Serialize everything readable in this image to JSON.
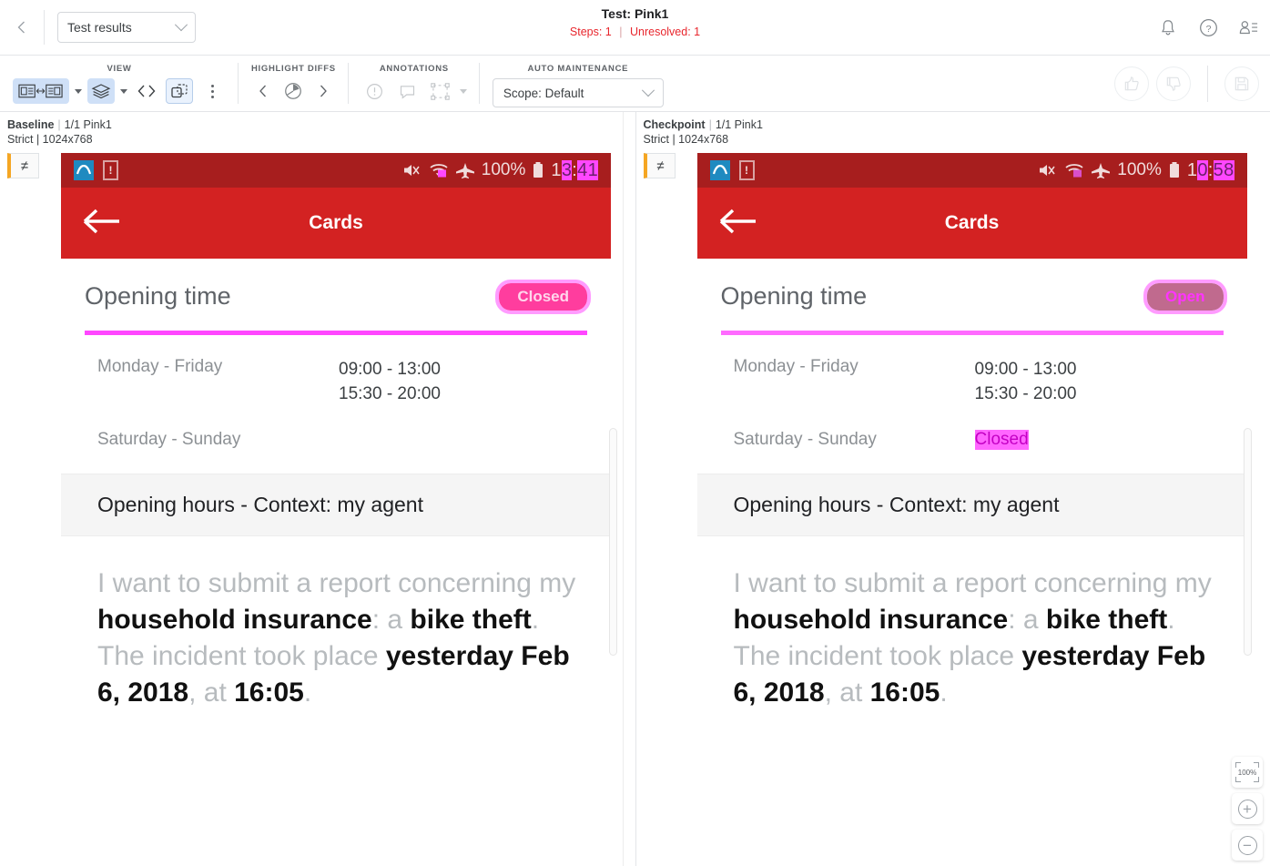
{
  "header": {
    "back_icon": "chevron-left-icon",
    "view_select": {
      "value": "Test results",
      "chevron": "chevron-down-icon"
    },
    "title": "Test: Pink1",
    "steps_label": "Steps: 1",
    "separator": "|",
    "unresolved_label": "Unresolved: 1",
    "icons": [
      "bell-icon",
      "help-icon",
      "user-list-icon"
    ],
    "accent_red": "#e8262d"
  },
  "toolbar": {
    "groups": [
      {
        "label": "VIEW",
        "items": [
          "side-by-side-icon",
          "layers-icon",
          "code-icon",
          "overlay-icon",
          "more-icon"
        ]
      },
      {
        "label": "HIGHLIGHT DIFFS",
        "items": [
          "prev-diff-icon",
          "diff-target-icon",
          "next-diff-icon"
        ]
      },
      {
        "label": "ANNOTATIONS",
        "items": [
          "issue-icon",
          "comment-icon",
          "region-icon"
        ]
      },
      {
        "label": "AUTO MAINTENANCE",
        "items": []
      }
    ],
    "view_label": "VIEW",
    "highlight_diffs_label": "HIGHLIGHT DIFFS",
    "annotations_label": "ANNOTATIONS",
    "auto_maintenance_label": "AUTO MAINTENANCE",
    "scope_select": {
      "value": "Scope: Default",
      "chevron": "chevron-down-icon"
    },
    "right_actions": [
      "thumbs-up-icon",
      "thumbs-down-icon",
      "save-icon"
    ]
  },
  "panes": {
    "baseline": {
      "kind": "Baseline",
      "sep": "|",
      "index": "1/1 Pink1",
      "meta": "Strict | 1024x768",
      "diff_chip": "≠",
      "status_bar": {
        "icons": [
          "mute-icon",
          "wifi-icon",
          "airplane-icon"
        ],
        "battery_pct": "100%",
        "battery_icon": "battery-icon",
        "time_plain_1": "1",
        "time_hl_1": "3",
        "time_colon": ":",
        "time_hl_2": "41",
        "time_full": "13:41"
      },
      "app_bar": {
        "back_icon": "arrow-left-icon",
        "title": "Cards"
      },
      "opening": {
        "title": "Opening time",
        "badge": "Closed",
        "badge_bg": "#ff3d9e",
        "badge_fg": "#ffd6ec"
      },
      "schedule": [
        {
          "day": "Monday - Friday",
          "times": [
            "09:00 - 13:00",
            "15:30 - 20:00"
          ],
          "value": "",
          "highlight": false
        },
        {
          "day": "Saturday - Sunday",
          "times": [],
          "value": "",
          "highlight": false
        }
      ],
      "context_title": "Opening hours - Context: my agent",
      "body": [
        {
          "t": "I want to submit a report concerning my ",
          "b": false
        },
        {
          "t": "household insurance",
          "b": true
        },
        {
          "t": ": ",
          "b": false
        },
        {
          "t": "a",
          "b": false
        },
        {
          "t": " ",
          "b": false
        },
        {
          "t": "bike theft",
          "b": true
        },
        {
          "t": ". ",
          "b": false
        },
        {
          "t": "The incident took place ",
          "b": false
        },
        {
          "t": "yesterday Feb 6, 2018",
          "b": true
        },
        {
          "t": ", ",
          "b": false
        },
        {
          "t": "at ",
          "b": false
        },
        {
          "t": "16:05",
          "b": true
        },
        {
          "t": ".",
          "b": false
        }
      ]
    },
    "checkpoint": {
      "kind": "Checkpoint",
      "sep": "|",
      "index": "1/1 Pink1",
      "meta": "Strict | 1024x768",
      "diff_chip": "≠",
      "status_bar": {
        "icons": [
          "mute-icon",
          "wifi-icon",
          "airplane-icon"
        ],
        "battery_pct": "100%",
        "battery_icon": "battery-icon",
        "time_plain_1": "1",
        "time_hl_1": "0",
        "time_colon": ":",
        "time_hl_2": "58",
        "time_full": "10:58"
      },
      "app_bar": {
        "back_icon": "arrow-left-icon",
        "title": "Cards"
      },
      "opening": {
        "title": "Opening time",
        "badge": "Open",
        "badge_bg": "#c06a8e",
        "badge_fg": "#ff33ff"
      },
      "schedule": [
        {
          "day": "Monday - Friday",
          "times": [
            "09:00 - 13:00",
            "15:30 - 20:00"
          ],
          "value": "",
          "highlight": false
        },
        {
          "day": "Saturday - Sunday",
          "times": [],
          "value": "Closed",
          "highlight": true
        }
      ],
      "context_title": "Opening hours - Context: my agent",
      "body": [
        {
          "t": "I want to submit a report concerning my ",
          "b": false
        },
        {
          "t": "household insurance",
          "b": true
        },
        {
          "t": ": ",
          "b": false
        },
        {
          "t": "a",
          "b": false
        },
        {
          "t": " ",
          "b": false
        },
        {
          "t": "bike theft",
          "b": true
        },
        {
          "t": ". ",
          "b": false
        },
        {
          "t": "The incident took place ",
          "b": false
        },
        {
          "t": "yesterday Feb 6, 2018",
          "b": true
        },
        {
          "t": ", ",
          "b": false
        },
        {
          "t": "at ",
          "b": false
        },
        {
          "t": "16:05",
          "b": true
        },
        {
          "t": ".",
          "b": false
        }
      ]
    }
  },
  "zoom_controls": {
    "fit_label": "100%",
    "zoom_in": "+",
    "zoom_out": "−"
  },
  "colors": {
    "status_bar_red": "#a71e1e",
    "app_bar_red": "#d32222",
    "diff_magenta": "#ff47ff",
    "diff_highlight": "#ff66ff",
    "accent_blue": "#cfe0f7"
  }
}
